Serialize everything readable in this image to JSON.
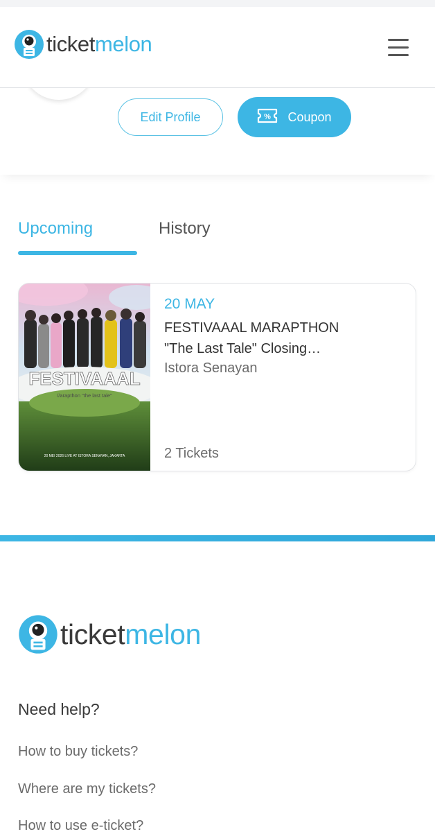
{
  "brand": {
    "name_part1": "ticket",
    "name_part2": "melon",
    "accent_color": "#3db6e4"
  },
  "header": {
    "menu_icon": "hamburger-menu-icon"
  },
  "profile": {
    "edit_label": "Edit Profile",
    "coupon_label": "Coupon",
    "coupon_icon": "ticket-percent-icon"
  },
  "tabs": {
    "upcoming": "Upcoming",
    "history": "History",
    "active": "upcoming"
  },
  "events": [
    {
      "date": "20 MAY",
      "title": "FESTIVAAAL MARAPTHON\n\"The Last Tale\" Closing…",
      "venue": "Istora Senayan",
      "tickets": "2 Tickets",
      "poster_text": "FESTIVAAAL",
      "poster_subtitle": "//arapthon \"the last tale\"",
      "poster_footer": "20 MEI 2026 LIVE AT ISTORA SENAYAN, JAKARTA"
    }
  ],
  "footer": {
    "help_title": "Need help?",
    "links": [
      "How to buy tickets?",
      "Where are my tickets?",
      "How to use e-ticket?"
    ]
  }
}
